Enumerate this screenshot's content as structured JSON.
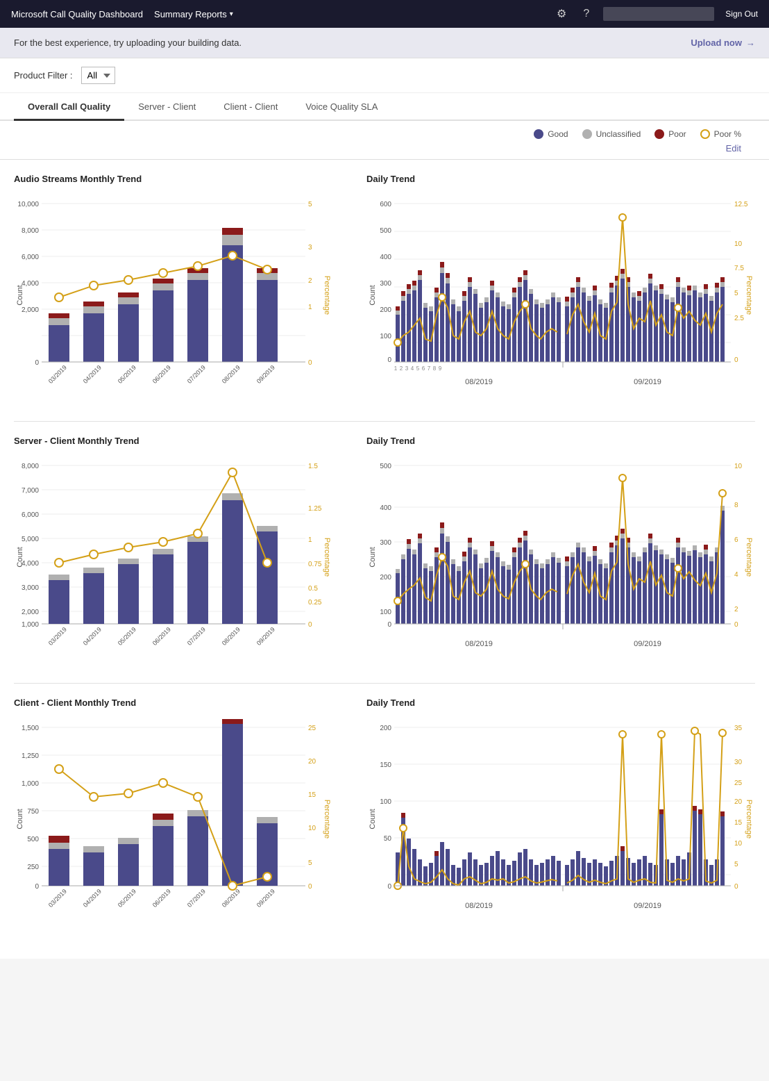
{
  "header": {
    "brand": "Microsoft Call Quality Dashboard",
    "nav_label": "Summary Reports",
    "nav_chevron": "▾",
    "gear_icon": "⚙",
    "help_icon": "?",
    "search_placeholder": "",
    "signout": "Sign Out"
  },
  "banner": {
    "text": "For the best experience, try uploading your building data.",
    "link": "Upload now",
    "arrow": "→"
  },
  "filter": {
    "label": "Product Filter :",
    "value": "All"
  },
  "tabs": [
    {
      "label": "Overall Call Quality",
      "active": true
    },
    {
      "label": "Server - Client",
      "active": false
    },
    {
      "label": "Client - Client",
      "active": false
    },
    {
      "label": "Voice Quality SLA",
      "active": false
    }
  ],
  "legend": {
    "items": [
      {
        "label": "Good",
        "type": "good"
      },
      {
        "label": "Unclassified",
        "type": "unclassified"
      },
      {
        "label": "Poor",
        "type": "poor"
      },
      {
        "label": "Poor %",
        "type": "poor-pct"
      }
    ]
  },
  "edit_label": "Edit",
  "charts": {
    "row1": {
      "left_title": "Audio Streams Monthly Trend",
      "right_title": "Daily Trend",
      "left_months": [
        "03/2019",
        "04/2019",
        "05/2019",
        "06/2019",
        "07/2019",
        "08/2019",
        "09/2019"
      ],
      "right_months_labels": [
        "08/2019",
        "09/2019"
      ]
    },
    "row2": {
      "left_title": "Server - Client Monthly Trend",
      "right_title": "Daily Trend"
    },
    "row3": {
      "left_title": "Client - Client Monthly Trend",
      "right_title": "Daily Trend"
    }
  }
}
